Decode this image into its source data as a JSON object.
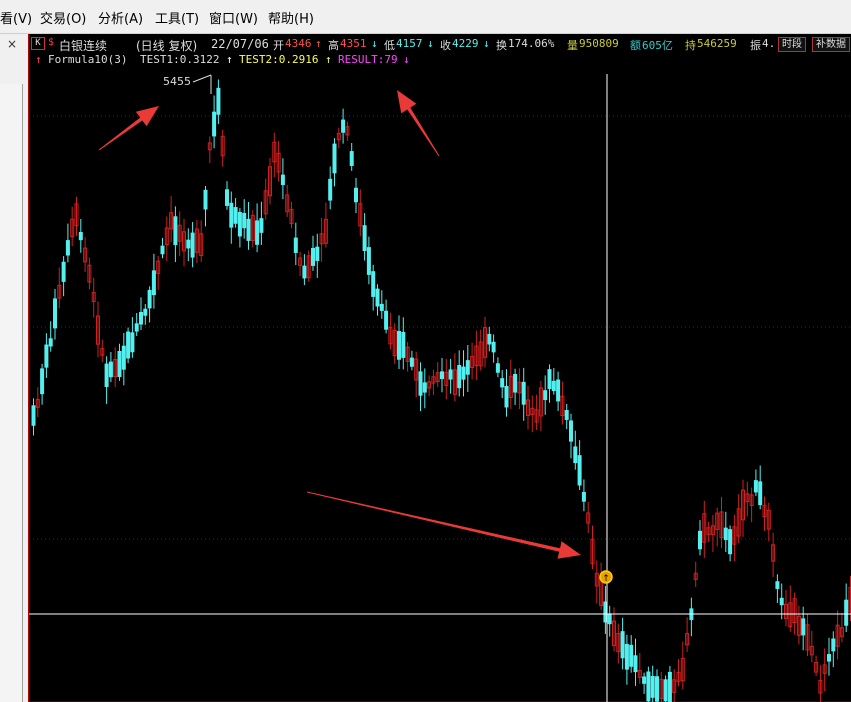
{
  "menu": {
    "items": [
      "看(V)",
      "交易(O)",
      "分析(A)",
      "工具(T)",
      "窗口(W)",
      "帮助(H)"
    ]
  },
  "left": {
    "close_glyph": "×"
  },
  "header": {
    "kline_icon": "K",
    "dollar": "$",
    "stock_name": "白银连续",
    "period": "(日线 复权)",
    "date": "22/07/06",
    "open_label": "开",
    "open_value": "4346",
    "high_label": "高",
    "high_value": "4351",
    "low_label": "低",
    "low_value": "4157",
    "close_label": "收",
    "close_value": "4229",
    "turnover_label": "换",
    "turnover_value": "174.06%",
    "volume_label": "量",
    "volume_value": "950809",
    "amount_label": "额",
    "amount_value": "605亿",
    "hold_label": "持",
    "hold_value": "546259",
    "amp_label": "振",
    "amp_value": "4.",
    "btn_period": "时段",
    "btn_data": "补数据"
  },
  "indicator": {
    "name": "Formula10(3)",
    "test1": "TEST1:0.3122",
    "test2": "TEST2:0.2916",
    "result": "RESULT:79"
  },
  "annotations": {
    "peak_label": "5455"
  },
  "colors": {
    "up": "#d02020",
    "down": "#54f0f0",
    "arrow": "#e83a36",
    "grid": "#7a1010",
    "test2": "#ffff55",
    "result": "#ff44ff",
    "volume": "#cccc33",
    "amount": "#33cccc",
    "hold": "#cccc33"
  }
}
